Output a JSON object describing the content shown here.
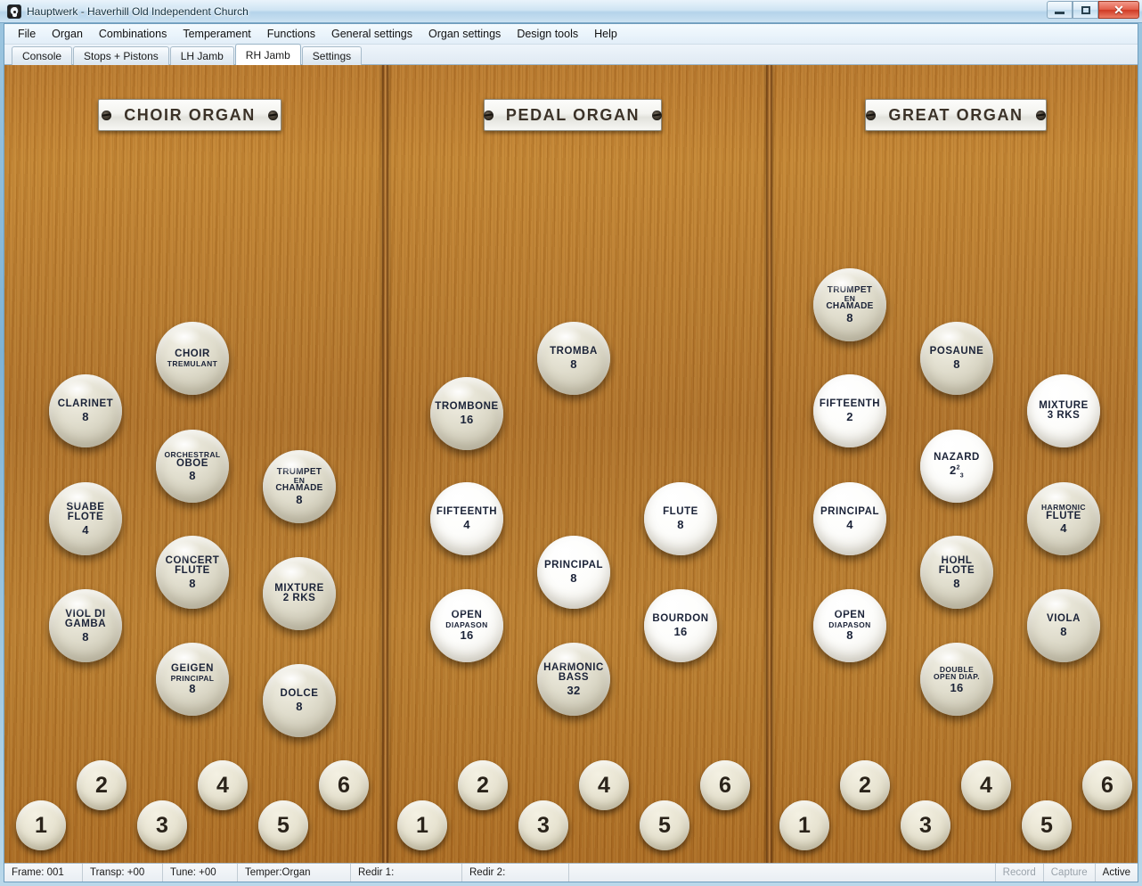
{
  "window": {
    "title": "Hauptwerk - Haverhill Old Independent Church",
    "minimize_label": "Minimize",
    "maximize_label": "Maximize",
    "close_label": "✕"
  },
  "menu": {
    "items": [
      {
        "label": "File"
      },
      {
        "label": "Organ"
      },
      {
        "label": "Combinations"
      },
      {
        "label": "Temperament"
      },
      {
        "label": "Functions"
      },
      {
        "label": "General settings"
      },
      {
        "label": "Organ settings"
      },
      {
        "label": "Design tools"
      },
      {
        "label": "Help"
      }
    ]
  },
  "tabs": {
    "items": [
      {
        "label": "Console",
        "active": false
      },
      {
        "label": "Stops + Pistons",
        "active": false
      },
      {
        "label": "LH Jamb",
        "active": false
      },
      {
        "label": "RH Jamb",
        "active": true
      },
      {
        "label": "Settings",
        "active": false
      }
    ]
  },
  "divisions": [
    {
      "id": "choir",
      "nameplate": "CHOIR ORGAN",
      "stops": [
        {
          "name": "CHOIR TREMULANT",
          "lines": [
            "CHOIR",
            "TREMULANT"
          ],
          "pitch": "",
          "state": "off"
        },
        {
          "name": "CLARINET",
          "lines": [
            "CLARINET"
          ],
          "pitch": "8",
          "state": "off"
        },
        {
          "name": "ORCHESTRAL OBOE",
          "lines": [
            "ORCHESTRAL",
            "OBOE"
          ],
          "pitch": "8",
          "state": "off"
        },
        {
          "name": "TRUMPET EN CHAMADE",
          "lines": [
            "TRUMPET",
            "EN",
            "CHAMADE"
          ],
          "pitch": "8",
          "state": "off"
        },
        {
          "name": "SUABE FLOTE",
          "lines": [
            "SUABE",
            "FLOTE"
          ],
          "pitch": "4",
          "state": "off"
        },
        {
          "name": "MIXTURE 2 RKS",
          "lines": [
            "MIXTURE",
            "2 RKS"
          ],
          "pitch": "",
          "state": "off"
        },
        {
          "name": "CONCERT FLUTE",
          "lines": [
            "CONCERT",
            "FLUTE"
          ],
          "pitch": "8",
          "state": "off"
        },
        {
          "name": "VIOL DI GAMBA",
          "lines": [
            "VIOL DI",
            "GAMBA"
          ],
          "pitch": "8",
          "state": "off"
        },
        {
          "name": "DOLCE",
          "lines": [
            "DOLCE"
          ],
          "pitch": "8",
          "state": "off"
        },
        {
          "name": "GEIGEN PRINCIPAL",
          "lines": [
            "GEIGEN",
            "PRINCIPAL"
          ],
          "pitch": "8",
          "state": "off"
        }
      ],
      "pistons": [
        "1",
        "2",
        "3",
        "4",
        "5",
        "6"
      ]
    },
    {
      "id": "pedal",
      "nameplate": "PEDAL  ORGAN",
      "stops": [
        {
          "name": "TROMBA",
          "lines": [
            "TROMBA"
          ],
          "pitch": "8",
          "state": "off"
        },
        {
          "name": "TROMBONE",
          "lines": [
            "TROMBONE"
          ],
          "pitch": "16",
          "state": "off"
        },
        {
          "name": "FIFTEENTH",
          "lines": [
            "FIFTEENTH"
          ],
          "pitch": "4",
          "state": "on"
        },
        {
          "name": "FLUTE",
          "lines": [
            "FLUTE"
          ],
          "pitch": "8",
          "state": "on"
        },
        {
          "name": "PRINCIPAL",
          "lines": [
            "PRINCIPAL"
          ],
          "pitch": "8",
          "state": "on"
        },
        {
          "name": "OPEN DIAPASON",
          "lines": [
            "OPEN",
            "DIAPASON"
          ],
          "pitch": "16",
          "state": "on"
        },
        {
          "name": "BOURDON",
          "lines": [
            "BOURDON"
          ],
          "pitch": "16",
          "state": "on"
        },
        {
          "name": "HARMONIC BASS",
          "lines": [
            "HARMONIC",
            "BASS"
          ],
          "pitch": "32",
          "state": "off"
        }
      ],
      "pistons": [
        "1",
        "2",
        "3",
        "4",
        "5",
        "6"
      ]
    },
    {
      "id": "great",
      "nameplate": "GREAT ORGAN",
      "stops": [
        {
          "name": "TRUMPET EN CHAMADE",
          "lines": [
            "TRUMPET",
            "EN",
            "CHAMADE"
          ],
          "pitch": "8",
          "state": "off"
        },
        {
          "name": "POSAUNE",
          "lines": [
            "POSAUNE"
          ],
          "pitch": "8",
          "state": "off"
        },
        {
          "name": "FIFTEENTH",
          "lines": [
            "FIFTEENTH"
          ],
          "pitch": "2",
          "state": "on"
        },
        {
          "name": "NAZARD",
          "lines": [
            "NAZARD"
          ],
          "pitch": "2 2/3",
          "state": "on"
        },
        {
          "name": "MIXTURE 3 RKS",
          "lines": [
            "MIXTURE",
            "3 RKS"
          ],
          "pitch": "",
          "state": "on"
        },
        {
          "name": "PRINCIPAL",
          "lines": [
            "PRINCIPAL"
          ],
          "pitch": "4",
          "state": "on"
        },
        {
          "name": "HOHL FLOTE",
          "lines": [
            "HOHL",
            "FLOTE"
          ],
          "pitch": "8",
          "state": "off"
        },
        {
          "name": "HARMONIC FLUTE",
          "lines": [
            "HARMONIC",
            "FLUTE"
          ],
          "pitch": "4",
          "state": "off"
        },
        {
          "name": "OPEN DIAPASON",
          "lines": [
            "OPEN",
            "DIAPASON"
          ],
          "pitch": "8",
          "state": "on"
        },
        {
          "name": "DOUBLE OPEN DIAP.",
          "lines": [
            "DOUBLE",
            "OPEN DIAP."
          ],
          "pitch": "16",
          "state": "off"
        },
        {
          "name": "VIOLA",
          "lines": [
            "VIOLA"
          ],
          "pitch": "8",
          "state": "off"
        }
      ],
      "pistons": [
        "1",
        "2",
        "3",
        "4",
        "5",
        "6"
      ]
    }
  ],
  "statusbar": {
    "frame": "Frame: 001",
    "transpose": "Transp: +00",
    "tune": "Tune: +00",
    "temperament": "Temper:Organ",
    "redirect1": "Redir 1:",
    "redirect2": "Redir 2:",
    "record": "Record",
    "capture": "Capture",
    "active": "Active"
  }
}
